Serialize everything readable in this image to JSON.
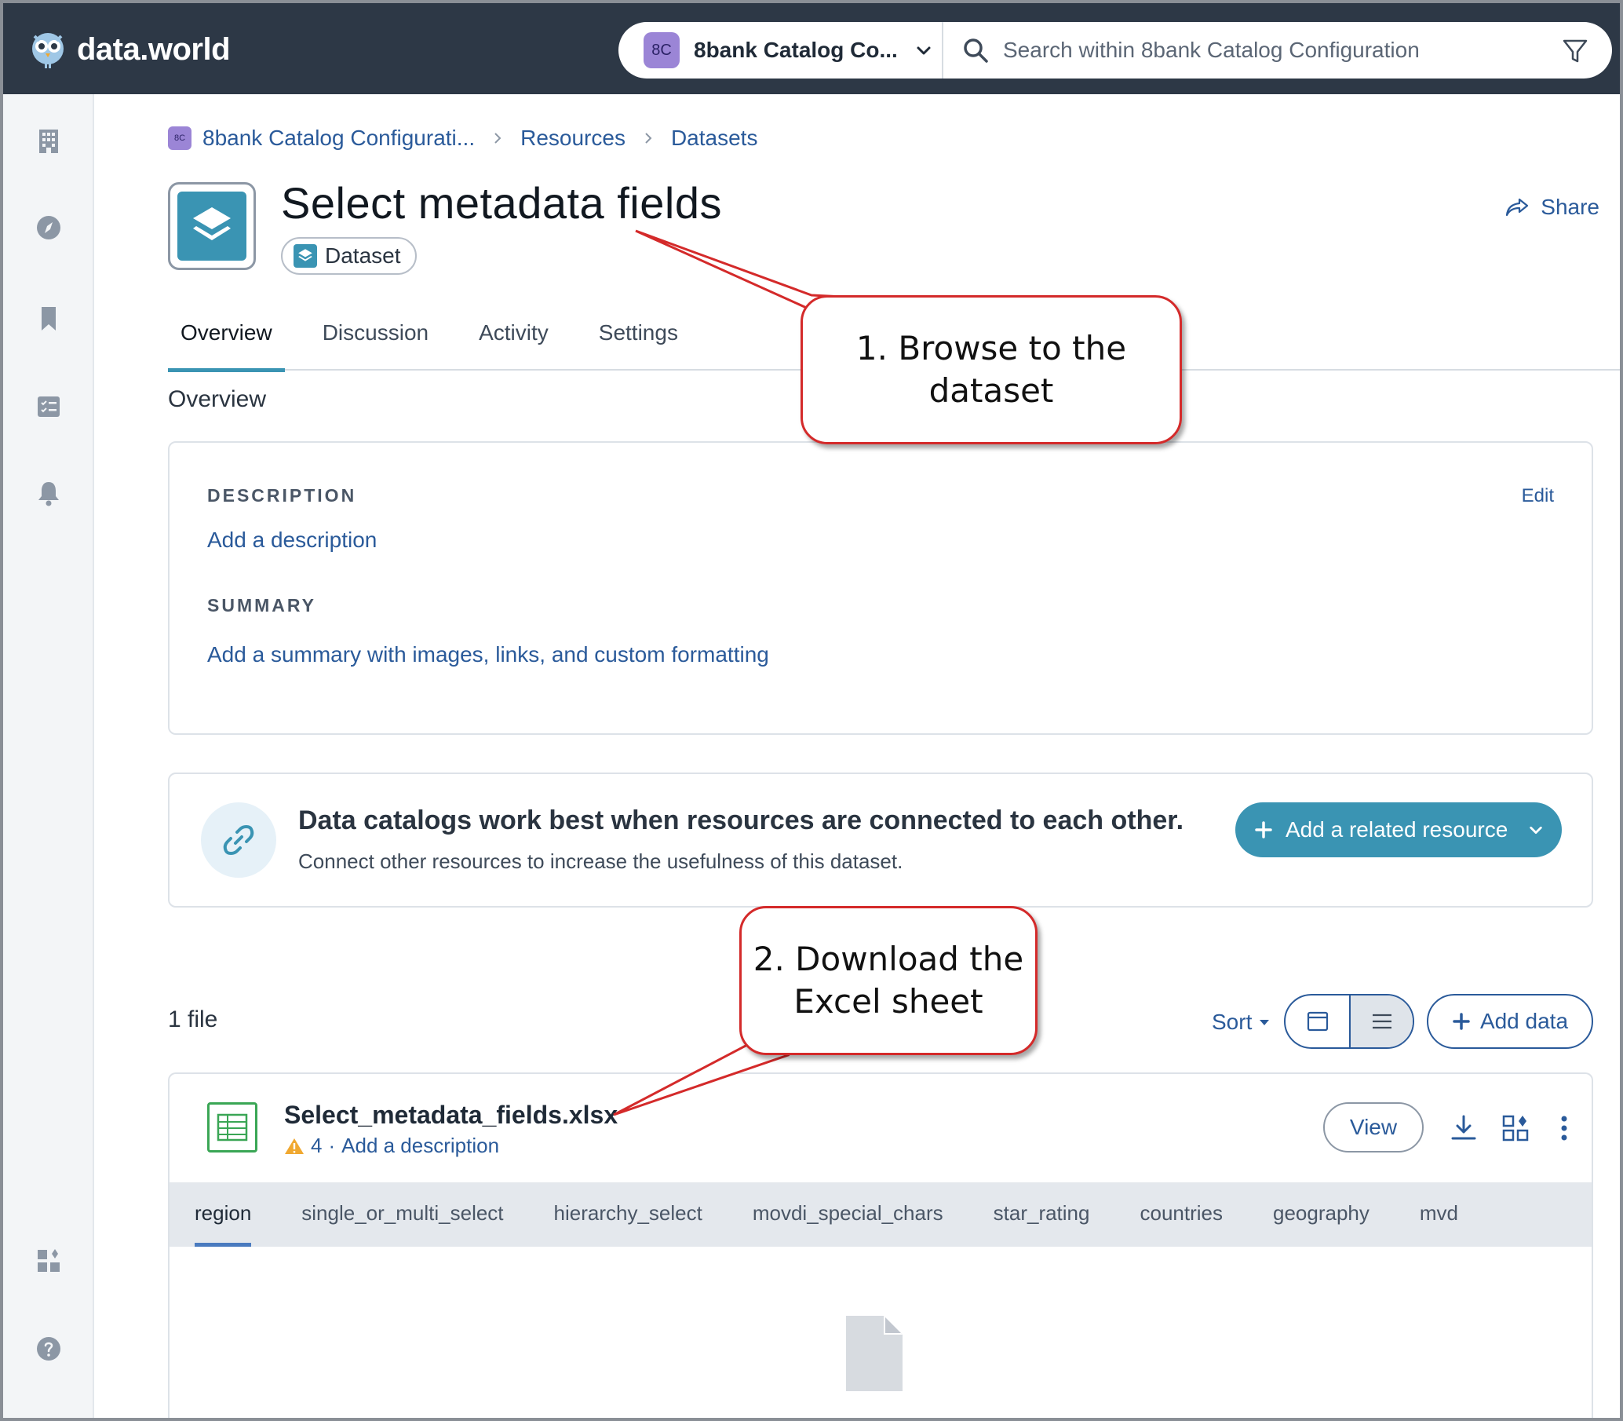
{
  "app": {
    "logo_text": "data.world",
    "org_badge": "8C",
    "org_name": "8bank Catalog Co...",
    "search_placeholder": "Search within 8bank Catalog Configuration"
  },
  "breadcrumb": {
    "badge": "8C",
    "items": [
      "8bank Catalog Configurati...",
      "Resources",
      "Datasets"
    ]
  },
  "page": {
    "title": "Select metadata fields",
    "type_label": "Dataset",
    "share_label": "Share"
  },
  "tabs": [
    "Overview",
    "Discussion",
    "Activity",
    "Settings"
  ],
  "overview": {
    "section_title": "Overview",
    "description_label": "DESCRIPTION",
    "description_link": "Add a description",
    "edit_label": "Edit",
    "summary_label": "SUMMARY",
    "summary_link": "Add a summary with images, links, and custom formatting"
  },
  "connect": {
    "title": "Data catalogs work best when resources are connected to each other.",
    "subtitle": "Connect other resources to increase the usefulness of this dataset.",
    "button_label": "Add a related resource"
  },
  "files": {
    "count_label": "1 file",
    "sort_label": "Sort",
    "add_data_label": "Add data",
    "file_name": "Select_metadata_fields.xlsx",
    "warning_count": "4",
    "meta_separator": "·",
    "meta_link": "Add a description",
    "view_label": "View",
    "columns": [
      "region",
      "single_or_multi_select",
      "hierarchy_select",
      "movdi_special_chars",
      "star_rating",
      "countries",
      "geography",
      "mvd"
    ]
  },
  "callouts": {
    "step1_line1": "1. Browse to the",
    "step1_line2": "dataset",
    "step2_line1": "2. Download the",
    "step2_line2": "Excel sheet"
  },
  "colors": {
    "topbar": "#2d3846",
    "accent": "#3a94b3",
    "link": "#2a5a9a",
    "callout_border": "#d42a2a"
  }
}
